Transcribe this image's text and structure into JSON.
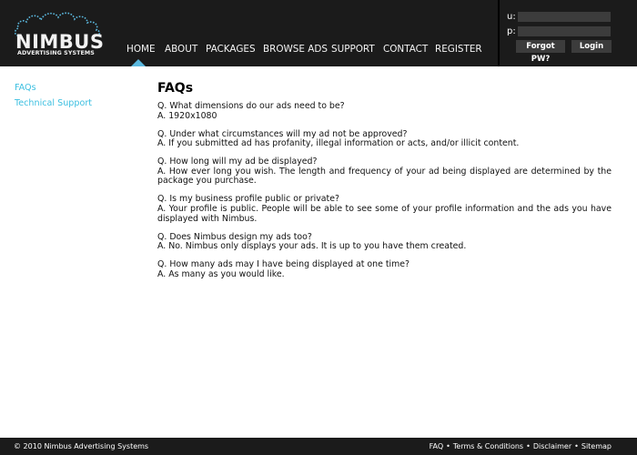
{
  "header": {
    "logo": {
      "name": "NIMBUS",
      "subtitle": "ADVERTISING SYSTEMS"
    },
    "nav": [
      {
        "label": "HOME",
        "active": true
      },
      {
        "label": "ABOUT"
      },
      {
        "label": "PACKAGES"
      },
      {
        "label": "BROWSE ADS"
      },
      {
        "label": "SUPPORT"
      },
      {
        "label": "CONTACT"
      },
      {
        "label": "REGISTER"
      }
    ],
    "login": {
      "username_label": "u:",
      "username_value": "",
      "password_label": "p:",
      "password_value": "",
      "forgot_label": "Forgot PW?",
      "login_label": "Login"
    }
  },
  "sidebar": {
    "items": [
      {
        "label": "FAQs"
      },
      {
        "label": "Technical Support"
      }
    ]
  },
  "main": {
    "title": "FAQs",
    "faqs": [
      {
        "q": "Q. What dimensions do our ads need to be?",
        "a": "A. 1920x1080"
      },
      {
        "q": "Q. Under what circumstances will my ad not be approved?",
        "a": "A. If you submitted ad has profanity, illegal information or acts, and/or illicit content."
      },
      {
        "q": "Q. How long will my ad be displayed?",
        "a": "A. How ever long you wish. The length and frequency of your ad being displayed are determined by the package you purchase."
      },
      {
        "q": "Q. Is my business profile public or private?",
        "a": "A. Your profile is public. People will be able to see some of your profile information and the ads you have displayed with Nimbus."
      },
      {
        "q": "Q. Does Nimbus design my ads too?",
        "a": "A. No. Nimbus only displays your ads. It is up to you have them created."
      },
      {
        "q": "Q. How many ads may I have being displayed at one time?",
        "a": "A. As many as you would like."
      }
    ]
  },
  "footer": {
    "copyright": "© 2010 Nimbus Advertising Systems",
    "links": [
      {
        "label": "FAQ"
      },
      {
        "label": "Terms & Conditions"
      },
      {
        "label": "Disclaimer"
      },
      {
        "label": "Sitemap"
      }
    ],
    "separator": "•"
  },
  "colors": {
    "header_bg": "#1b1b1b",
    "accent": "#5bb8de",
    "link": "#3bbfe0",
    "input_bg": "#3c3c3c"
  }
}
